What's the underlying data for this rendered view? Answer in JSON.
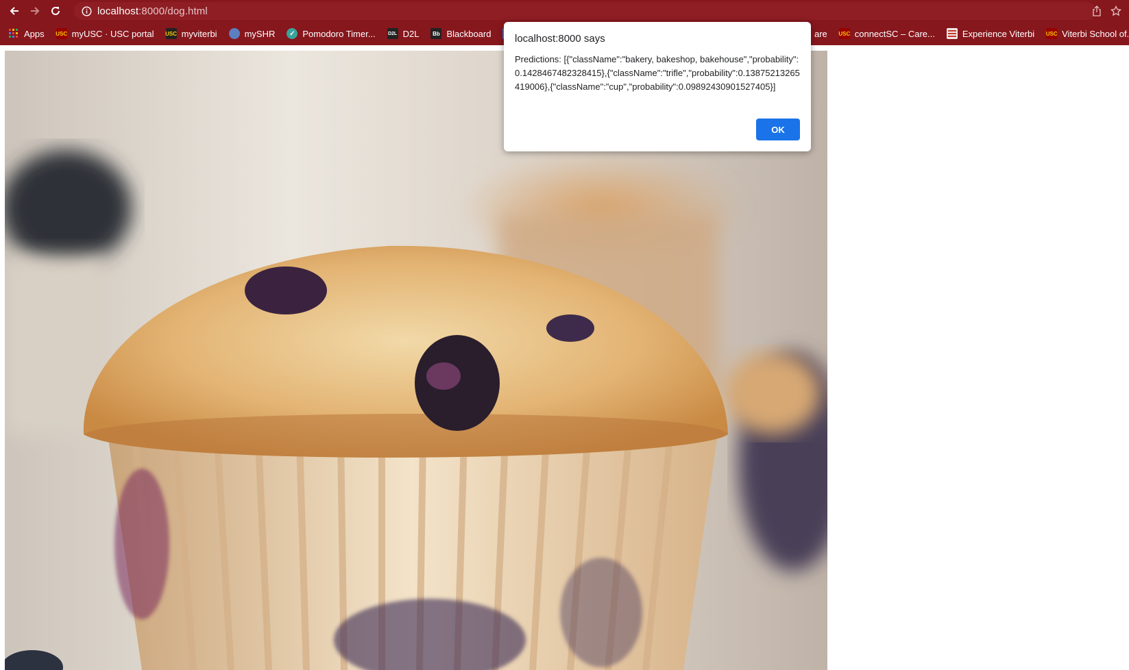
{
  "browser": {
    "url_host": "localhost",
    "url_path": ":8000/dog.html"
  },
  "bookmarks": [
    {
      "label": "Apps",
      "icon": "apps-grid-icon",
      "color": "#e8453c"
    },
    {
      "label": "myUSC · USC portal",
      "icon": "usc-icon",
      "color": "#990000"
    },
    {
      "label": "myviterbi",
      "icon": "usc-icon",
      "color": "#222222"
    },
    {
      "label": "mySHR",
      "icon": "globe-icon",
      "color": "#5b7fbf"
    },
    {
      "label": "Pomodoro Timer...",
      "icon": "check-circle-icon",
      "color": "#3aa39b"
    },
    {
      "label": "D2L",
      "icon": "d2l-icon",
      "color": "#222222"
    },
    {
      "label": "Blackboard",
      "icon": "bb-icon",
      "color": "#222222"
    }
  ],
  "bookmarks_right": [
    {
      "label": "are",
      "icon": "",
      "color": ""
    },
    {
      "label": "connectSC – Care...",
      "icon": "usc-icon",
      "color": "#990000"
    },
    {
      "label": "Experience Viterbi",
      "icon": "flag-icon",
      "color": "#c0392b"
    },
    {
      "label": "Viterbi School of...",
      "icon": "usc-icon",
      "color": "#990000"
    }
  ],
  "dialog": {
    "title": "localhost:8000 says",
    "message": "Predictions: [{\"className\":\"bakery, bakeshop, bakehouse\",\"probability\":0.1428467482328415},{\"className\":\"trifle\",\"probability\":0.13875213265419006},{\"className\":\"cup\",\"probability\":0.09892430901527405}]",
    "ok_label": "OK"
  },
  "colors": {
    "toolbar": "#86171d",
    "accent": "#1a73e8"
  }
}
